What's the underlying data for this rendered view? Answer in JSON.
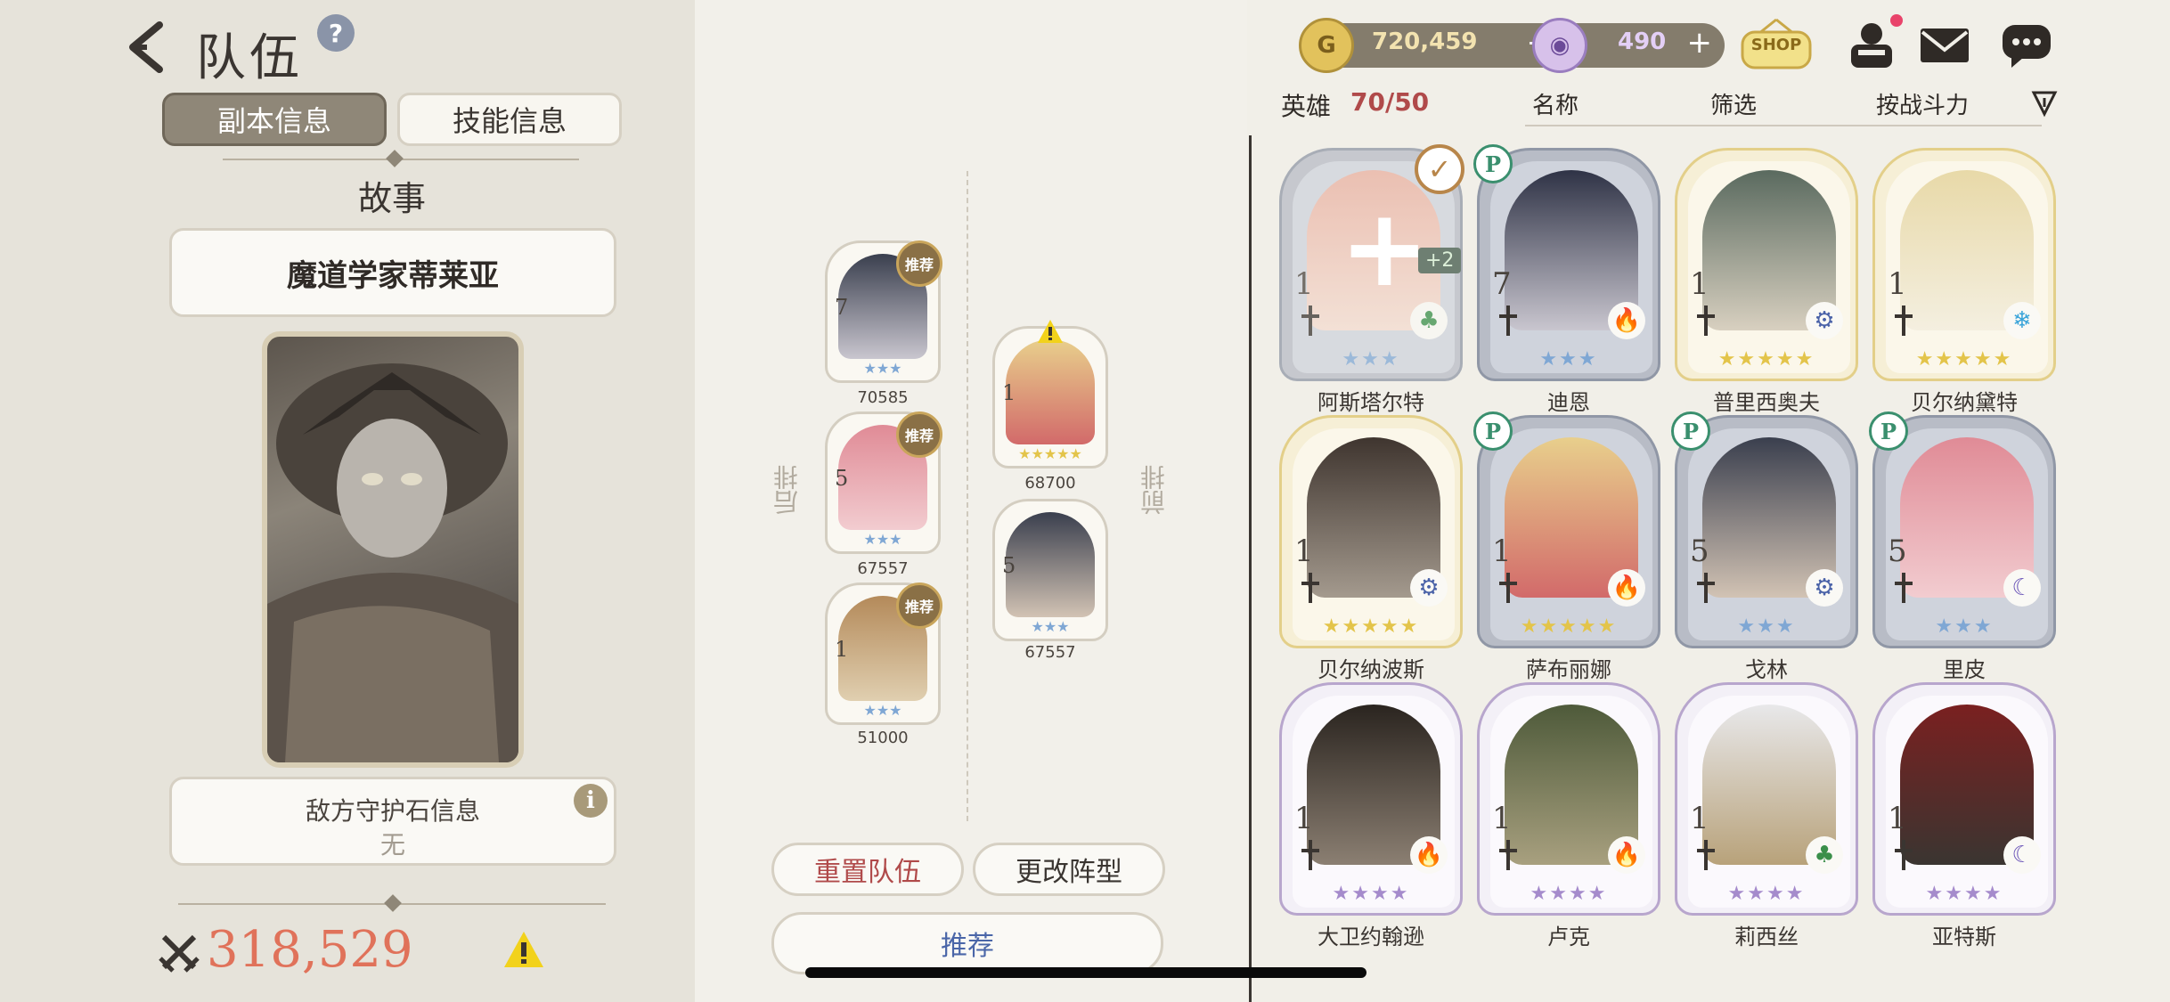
{
  "header": {
    "title": "队伍",
    "help_label": "?"
  },
  "tabs": {
    "dungeon_info": "副本信息",
    "skill_info": "技能信息"
  },
  "story": {
    "label": "故事",
    "dungeon_name": "魔道学家蒂莱亚"
  },
  "guardian": {
    "title": "敌方守护石信息",
    "value": "无",
    "info_label": "i"
  },
  "team_power": "318,529",
  "formation": {
    "back_row_label": "后排",
    "front_row_label": "前排",
    "recommend_badge": "推荐",
    "back_row": [
      {
        "level": "7",
        "power": "70585",
        "recommended": true,
        "stars": "★★★"
      },
      {
        "level": "5",
        "power": "67557",
        "recommended": true,
        "stars": "★★★"
      },
      {
        "level": "1",
        "power": "51000",
        "recommended": true,
        "stars": "★★★"
      }
    ],
    "front_row": [
      {
        "level": "1",
        "power": "68700",
        "warning": true,
        "stars": "★★★★★"
      },
      {
        "level": "5",
        "power": "67557",
        "stars": "★★★"
      }
    ],
    "reset_label": "重置队伍",
    "change_label": "更改阵型",
    "recommend_label": "推荐"
  },
  "currency": {
    "gold_icon": "G",
    "gold": "720,459",
    "gem": "490",
    "plus": "+",
    "shop_label": "SHOP"
  },
  "hero_list": {
    "label": "英雄",
    "count": "70/50",
    "sort_name": "名称",
    "filter": "筛选",
    "sort_power": "按战斗力",
    "p_badge": "P",
    "plus_badge": "+2",
    "heroes": [
      {
        "name": "阿斯塔尔特",
        "level": "1",
        "stars": "★★★",
        "element": "♣",
        "element_color": "#3a8f4a",
        "frame": "silver",
        "selected": true
      },
      {
        "name": "迪恩",
        "level": "7",
        "stars": "★★★",
        "element": "🔥",
        "element_color": "#d9583a",
        "frame": "silver",
        "p": true
      },
      {
        "name": "普里西奥夫",
        "level": "1",
        "stars": "★★★★★",
        "element": "⚙",
        "element_color": "#4a62a8",
        "frame": "gold"
      },
      {
        "name": "贝尔纳黛特",
        "level": "1",
        "stars": "★★★★★",
        "element": "❄",
        "element_color": "#3aa4d9",
        "frame": "gold"
      },
      {
        "name": "贝尔纳波斯",
        "level": "1",
        "stars": "★★★★★",
        "element": "⚙",
        "element_color": "#4a62a8",
        "frame": "gold"
      },
      {
        "name": "萨布丽娜",
        "level": "1",
        "stars": "★★★★★",
        "element": "🔥",
        "element_color": "#d9583a",
        "frame": "silver",
        "p": true
      },
      {
        "name": "戈林",
        "level": "5",
        "stars": "★★★",
        "element": "⚙",
        "element_color": "#4a62a8",
        "frame": "silver",
        "p": true
      },
      {
        "name": "里皮",
        "level": "5",
        "stars": "★★★",
        "element": "☾",
        "element_color": "#6b55b8",
        "frame": "silver",
        "p": true
      },
      {
        "name": "大卫约翰逊",
        "level": "1",
        "stars": "★★★★",
        "element": "🔥",
        "element_color": "#d9583a",
        "frame": "purple"
      },
      {
        "name": "卢克",
        "level": "1",
        "stars": "★★★★",
        "element": "🔥",
        "element_color": "#d9583a",
        "frame": "purple"
      },
      {
        "name": "莉西丝",
        "level": "1",
        "stars": "★★★★",
        "element": "♣",
        "element_color": "#3a8f4a",
        "frame": "purple"
      },
      {
        "name": "亚特斯",
        "level": "1",
        "stars": "★★★★",
        "element": "☾",
        "element_color": "#6b55b8",
        "frame": "purple"
      }
    ]
  }
}
